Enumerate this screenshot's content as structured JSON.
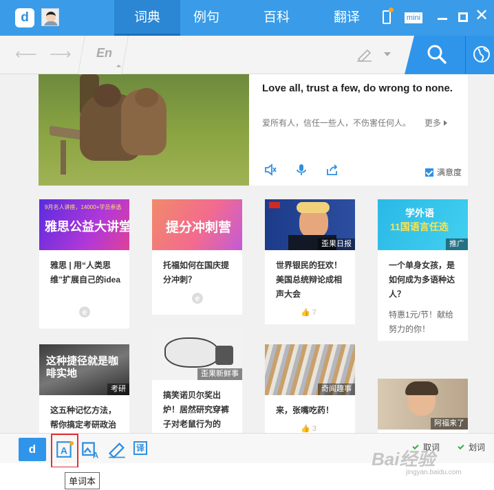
{
  "app": {
    "brand_colors": {
      "primary": "#3a9ce8",
      "search": "#2f95ea",
      "highlight": "#e03030"
    },
    "tabs": [
      {
        "label": "词典",
        "active": true
      },
      {
        "label": "例句",
        "active": false
      },
      {
        "label": "百科",
        "active": false
      },
      {
        "label": "翻译",
        "active": false
      }
    ],
    "window_controls": {
      "mini_label": "mini"
    }
  },
  "search": {
    "lang": "En",
    "placeholder": ""
  },
  "hero": {
    "quote_en": "Love all, trust a few, do wrong to none.",
    "quote_cn": "爱所有人，信任一些人，不伤害任何人。",
    "more": "更多",
    "satisfy": "满意度"
  },
  "cards": [
    {
      "thumb_text": "雅思公益大讲堂",
      "thumb_top": "9月名人讲座，14000+学员参选",
      "title": "雅思 | 用“人类思维”扩展自己的idea"
    },
    {
      "thumb_text": "提分冲刺营",
      "title": "托福如何在国庆提分冲刺？"
    },
    {
      "thumb_badge": "歪果日报",
      "title": "世界银民的狂欢！美国总统辩论成相声大会",
      "likes": "7"
    },
    {
      "thumb_text": "11国语言任选",
      "thumb_top": "学外语",
      "thumb_badge": "推广",
      "title": "一个单身女孩，是如何成为多语种达人？",
      "sub": "特惠1元/节！献给努力的你！"
    },
    {
      "thumb_text": "这种捷径就是咖啡实地",
      "thumb_badge": "考研",
      "title": "这五种记忆方法，帮你搞定考研政治"
    },
    {
      "thumb_badge": "歪果新鲜事",
      "title": "搞笑诺贝尔奖出炉！居然研究穿裤子对老鼠行为的"
    },
    {
      "thumb_badge": "奇闻趣事",
      "title": "来，张嘴吃药！",
      "likes": "3"
    },
    {
      "thumb_badge": "阿福来了"
    }
  ],
  "toolbar": {
    "tooltip": "单词本",
    "toggle1": "取词",
    "toggle2": "划词"
  },
  "watermark": {
    "main": "Bai经验",
    "sub": "jingyan.baidu.com"
  }
}
